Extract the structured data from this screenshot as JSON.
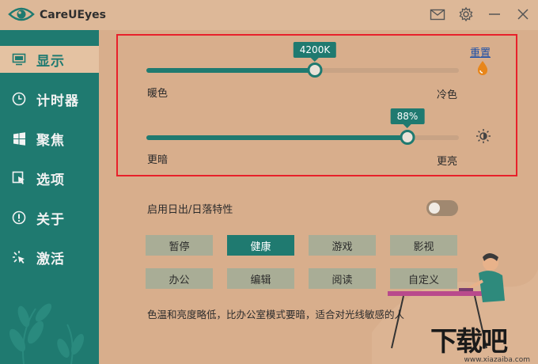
{
  "app": {
    "title": "CareUEyes"
  },
  "titlebar": {
    "icons": [
      "mail-icon",
      "gear-icon",
      "minimize-icon",
      "close-icon"
    ]
  },
  "sidebar": {
    "items": [
      {
        "label": "显示",
        "icon": "monitor-icon",
        "active": true
      },
      {
        "label": "计时器",
        "icon": "clock-icon",
        "active": false
      },
      {
        "label": "聚焦",
        "icon": "windows-icon",
        "active": false
      },
      {
        "label": "选项",
        "icon": "cursor-icon",
        "active": false
      },
      {
        "label": "关于",
        "icon": "info-icon",
        "active": false
      },
      {
        "label": "激活",
        "icon": "sparkle-icon",
        "active": false
      }
    ]
  },
  "display": {
    "reset_label": "重置",
    "color_temp": {
      "value_label": "4200K",
      "fraction": 0.54,
      "left_label": "暖色",
      "right_label": "冷色",
      "icon": "drop-icon"
    },
    "brightness": {
      "value_label": "88%",
      "fraction": 0.835,
      "left_label": "更暗",
      "right_label": "更亮",
      "icon": "sun-icon"
    },
    "sunrise_toggle_label": "启用日出/日落特性",
    "sunrise_toggle_on": false,
    "modes": [
      {
        "label": "暂停",
        "active": false
      },
      {
        "label": "健康",
        "active": true
      },
      {
        "label": "游戏",
        "active": false
      },
      {
        "label": "影视",
        "active": false
      },
      {
        "label": "办公",
        "active": false
      },
      {
        "label": "编辑",
        "active": false
      },
      {
        "label": "阅读",
        "active": false
      },
      {
        "label": "自定义",
        "active": false
      }
    ],
    "description": "色温和亮度略低，比办公室模式要暗，适合对光线敏感的人"
  },
  "watermark": {
    "text": "下载吧",
    "sub": "www.xiazaiba.com"
  },
  "colors": {
    "sidebar": "#1f7a70",
    "background": "#d8ae8c",
    "accent": "#1f7a70",
    "highlight_box": "#e8202a",
    "link": "#1c4fa8"
  }
}
